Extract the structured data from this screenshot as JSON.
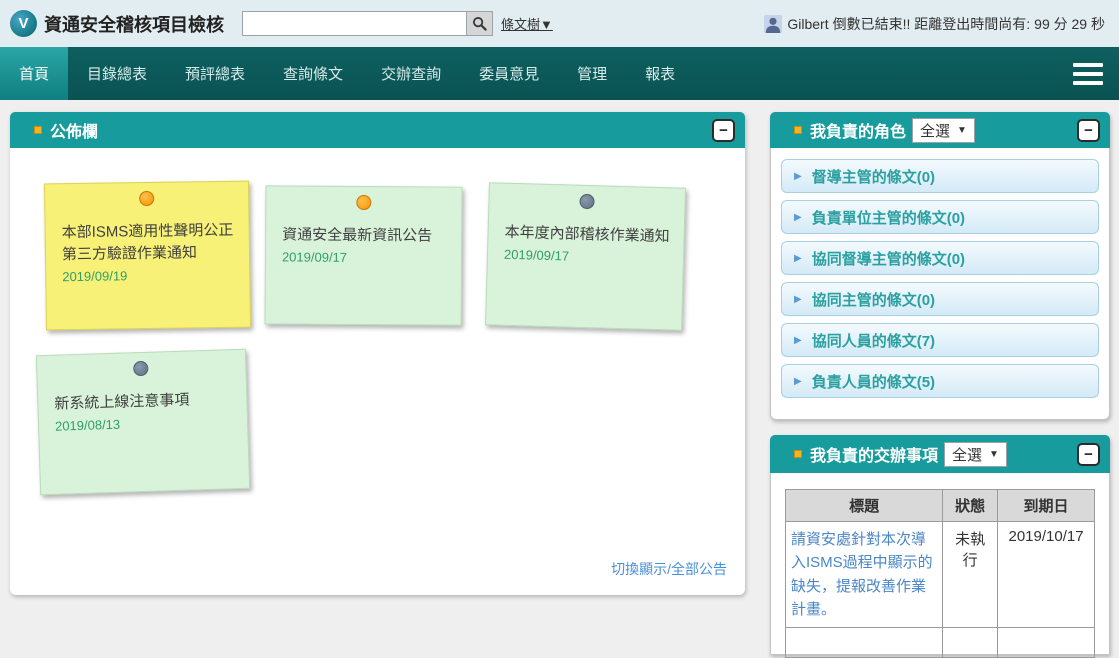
{
  "header": {
    "logo_glyph": "V",
    "app_title": "資通安全稽核項目檢核",
    "search_value": "",
    "tree_link": "條文樹▼",
    "user_name": "Gilbert",
    "session_message": "倒數已結束!! 距離登出時間尚有:",
    "time_remaining": "99 分 29 秒"
  },
  "nav": {
    "items": [
      {
        "label": "首頁",
        "active": true
      },
      {
        "label": "目錄總表",
        "active": false
      },
      {
        "label": "預評總表",
        "active": false
      },
      {
        "label": "查詢條文",
        "active": false
      },
      {
        "label": "交辦查詢",
        "active": false
      },
      {
        "label": "委員意見",
        "active": false
      },
      {
        "label": "管理",
        "active": false
      },
      {
        "label": "報表",
        "active": false
      }
    ]
  },
  "icons": {
    "collapse": "−",
    "dropdown_caret": "▼",
    "role_triangle": "▶"
  },
  "bulletin": {
    "title": "公佈欄",
    "notes": [
      {
        "title": "本部ISMS適用性聲明公正第三方驗證作業通知",
        "date": "2019/09/19",
        "color": "yellow",
        "pin": "orange"
      },
      {
        "title": "資通安全最新資訊公告",
        "date": "2019/09/17",
        "color": "green",
        "pin": "orange"
      },
      {
        "title": "本年度內部稽核作業通知",
        "date": "2019/09/17",
        "color": "green",
        "pin": "gray"
      },
      {
        "title": "新系統上線注意事項",
        "date": "2019/08/13",
        "color": "green",
        "pin": "gray"
      }
    ],
    "footer_link": "切換顯示/全部公告"
  },
  "roles": {
    "title": "我負責的角色",
    "filter_value": "全選",
    "items": [
      {
        "label": "督導主管的條文(0)"
      },
      {
        "label": "負責單位主管的條文(0)"
      },
      {
        "label": "協同督導主管的條文(0)"
      },
      {
        "label": "協同主管的條文(0)"
      },
      {
        "label": "協同人員的條文(7)"
      },
      {
        "label": "負責人員的條文(5)"
      }
    ]
  },
  "tasks": {
    "title": "我負責的交辦事項",
    "filter_value": "全選",
    "headers": [
      "標題",
      "狀態",
      "到期日"
    ],
    "rows": [
      {
        "title": "請資安處針對本次導入ISMS過程中顯示的缺失，提報改善作業計畫。",
        "status": "未執行",
        "due": "2019/10/17"
      }
    ]
  },
  "colors": {
    "nav_bg": "#0c5a5a",
    "nav_active": "#1f9e9e",
    "panel_header": "#179b9c",
    "header_bg": "#e2edf2",
    "note_yellow": "#f7f178",
    "note_green": "#d9f3da",
    "pin_orange": "#f59300",
    "pin_gray": "#5f7085",
    "role_text": "#2aa0a0",
    "link_blue": "#4a86c8",
    "date_green": "#2f9e68"
  }
}
